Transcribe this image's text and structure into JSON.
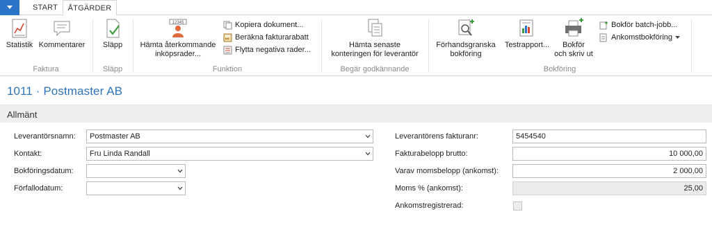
{
  "tabs": [
    {
      "label": "START"
    },
    {
      "label": "ÅTGÄRDER"
    }
  ],
  "ribbon": {
    "faktura": {
      "label": "Faktura",
      "statistik": "Statistik",
      "kommentarer": "Kommentarer"
    },
    "slapp": {
      "label": "Släpp",
      "slapp_button": "Släpp"
    },
    "funktion": {
      "label": "Funktion",
      "hamta_line1": "Hämta återkommande",
      "hamta_line2": "inköpsrader...",
      "kopiera": "Kopiera dokument...",
      "berakna": "Beräkna fakturarabatt",
      "flytta": "Flytta negativa rader..."
    },
    "begar": {
      "label": "Begär godkännande",
      "hamta_line1": "Hämta senaste",
      "hamta_line2": "konteringen för leverantör"
    },
    "bokforing": {
      "label": "Bokföring",
      "forhands_line1": "Förhandsgranska",
      "forhands_line2": "bokföring",
      "testrapport": "Testrapport...",
      "bokfor_line1": "Bokför",
      "bokfor_line2": "och skriv ut",
      "batch": "Bokför batch-jobb...",
      "ankomst": "Ankomstbokföring"
    }
  },
  "page": {
    "title": "1011 · Postmaster AB",
    "section": "Allmänt"
  },
  "form": {
    "leverantorsnamn": {
      "label": "Leverantörsnamn:",
      "value": "Postmaster AB"
    },
    "kontakt": {
      "label": "Kontakt:",
      "value": "Fru Linda Randall"
    },
    "bokforingsdatum": {
      "label": "Bokföringsdatum:",
      "value": ""
    },
    "forfallodatum": {
      "label": "Förfallodatum:",
      "value": ""
    },
    "fakturanr": {
      "label": "Leverantörens fakturanr:",
      "value": "5454540"
    },
    "brutto": {
      "label": "Fakturabelopp brutto:",
      "value": "10 000,00"
    },
    "moms_belopp": {
      "label": "Varav momsbelopp (ankomst):",
      "value": "2 000,00"
    },
    "moms_pct": {
      "label": "Moms % (ankomst):",
      "value": "25,00"
    },
    "ankomstregistrerad": {
      "label": "Ankomstregistrerad:",
      "checked": false
    }
  },
  "colors": {
    "accent": "#2b74c7",
    "title": "#2f73b9"
  }
}
